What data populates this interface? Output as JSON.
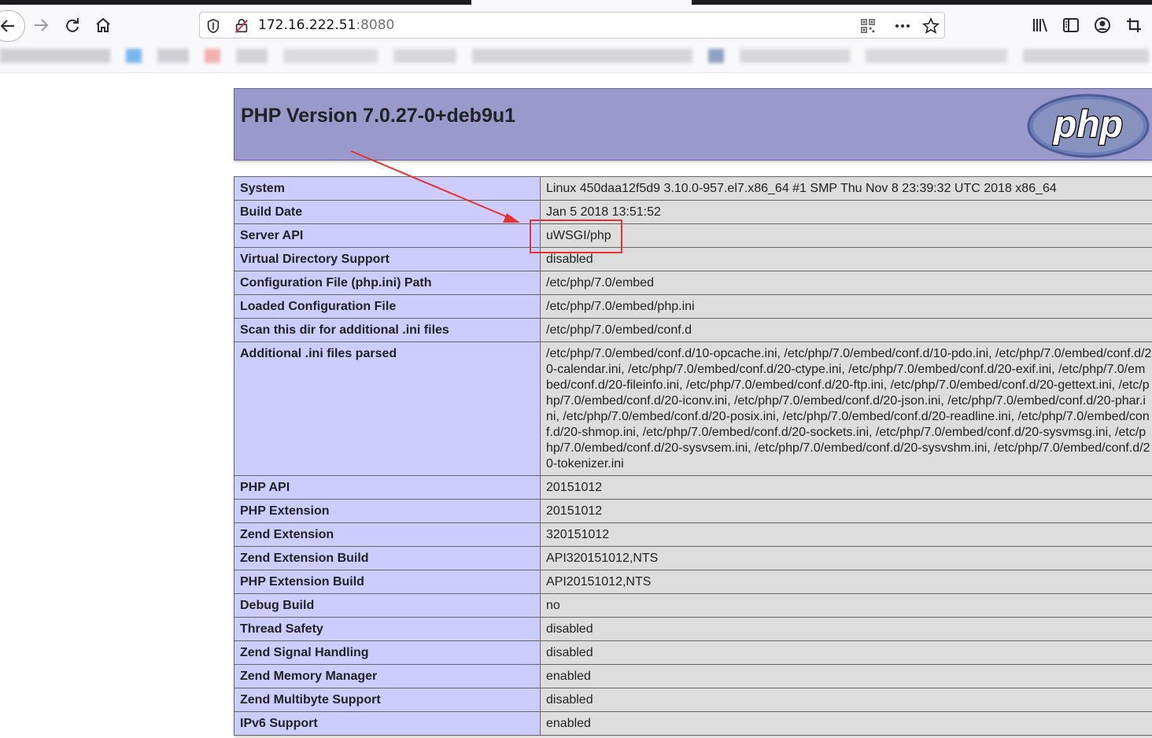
{
  "browser": {
    "url_host": "172.16.222.51",
    "url_port": ":8080",
    "icons": {
      "back": "back-arrow-icon",
      "forward": "forward-arrow-icon",
      "reload": "reload-icon",
      "home": "home-icon",
      "shield": "tracking-protection-shield-icon",
      "insecure": "insecure-connection-icon",
      "qr": "qr-code-icon",
      "more": "more-actions-icon",
      "star": "bookmark-star-icon",
      "library": "library-icon",
      "sidebar": "sidebar-icon",
      "account": "account-icon",
      "screenshot": "screenshot-crop-icon"
    }
  },
  "page": {
    "title": "PHP Version 7.0.27-0+deb9u1",
    "logo_text": "php",
    "rows": [
      {
        "name": "System",
        "value": "Linux 450daa12f5d9 3.10.0-957.el7.x86_64 #1 SMP Thu Nov 8 23:39:32 UTC 2018 x86_64"
      },
      {
        "name": "Build Date",
        "value": "Jan 5 2018 13:51:52"
      },
      {
        "name": "Server API",
        "value": "uWSGI/php"
      },
      {
        "name": "Virtual Directory Support",
        "value": "disabled"
      },
      {
        "name": "Configuration File (php.ini) Path",
        "value": "/etc/php/7.0/embed"
      },
      {
        "name": "Loaded Configuration File",
        "value": "/etc/php/7.0/embed/php.ini"
      },
      {
        "name": "Scan this dir for additional .ini files",
        "value": "/etc/php/7.0/embed/conf.d"
      },
      {
        "name": "Additional .ini files parsed",
        "value": "/etc/php/7.0/embed/conf.d/10-opcache.ini, /etc/php/7.0/embed/conf.d/10-pdo.ini, /etc/php/7.0/embed/conf.d/20-calendar.ini, /etc/php/7.0/embed/conf.d/20-ctype.ini, /etc/php/7.0/embed/conf.d/20-exif.ini, /etc/php/7.0/embed/conf.d/20-fileinfo.ini, /etc/php/7.0/embed/conf.d/20-ftp.ini, /etc/php/7.0/embed/conf.d/20-gettext.ini, /etc/php/7.0/embed/conf.d/20-iconv.ini, /etc/php/7.0/embed/conf.d/20-json.ini, /etc/php/7.0/embed/conf.d/20-phar.ini, /etc/php/7.0/embed/conf.d/20-posix.ini, /etc/php/7.0/embed/conf.d/20-readline.ini, /etc/php/7.0/embed/conf.d/20-shmop.ini, /etc/php/7.0/embed/conf.d/20-sockets.ini, /etc/php/7.0/embed/conf.d/20-sysvmsg.ini, /etc/php/7.0/embed/conf.d/20-sysvsem.ini, /etc/php/7.0/embed/conf.d/20-sysvshm.ini, /etc/php/7.0/embed/conf.d/20-tokenizer.ini"
      },
      {
        "name": "PHP API",
        "value": "20151012"
      },
      {
        "name": "PHP Extension",
        "value": "20151012"
      },
      {
        "name": "Zend Extension",
        "value": "320151012"
      },
      {
        "name": "Zend Extension Build",
        "value": "API320151012,NTS"
      },
      {
        "name": "PHP Extension Build",
        "value": "API20151012,NTS"
      },
      {
        "name": "Debug Build",
        "value": "no"
      },
      {
        "name": "Thread Safety",
        "value": "disabled"
      },
      {
        "name": "Zend Signal Handling",
        "value": "disabled"
      },
      {
        "name": "Zend Memory Manager",
        "value": "enabled"
      },
      {
        "name": "Zend Multibyte Support",
        "value": "disabled"
      },
      {
        "name": "IPv6 Support",
        "value": "enabled"
      }
    ]
  },
  "colors": {
    "header_bg": "#9999cc",
    "key_cell_bg": "#ccccff",
    "value_cell_bg": "#dddddd",
    "annotation": "#e8322f"
  }
}
